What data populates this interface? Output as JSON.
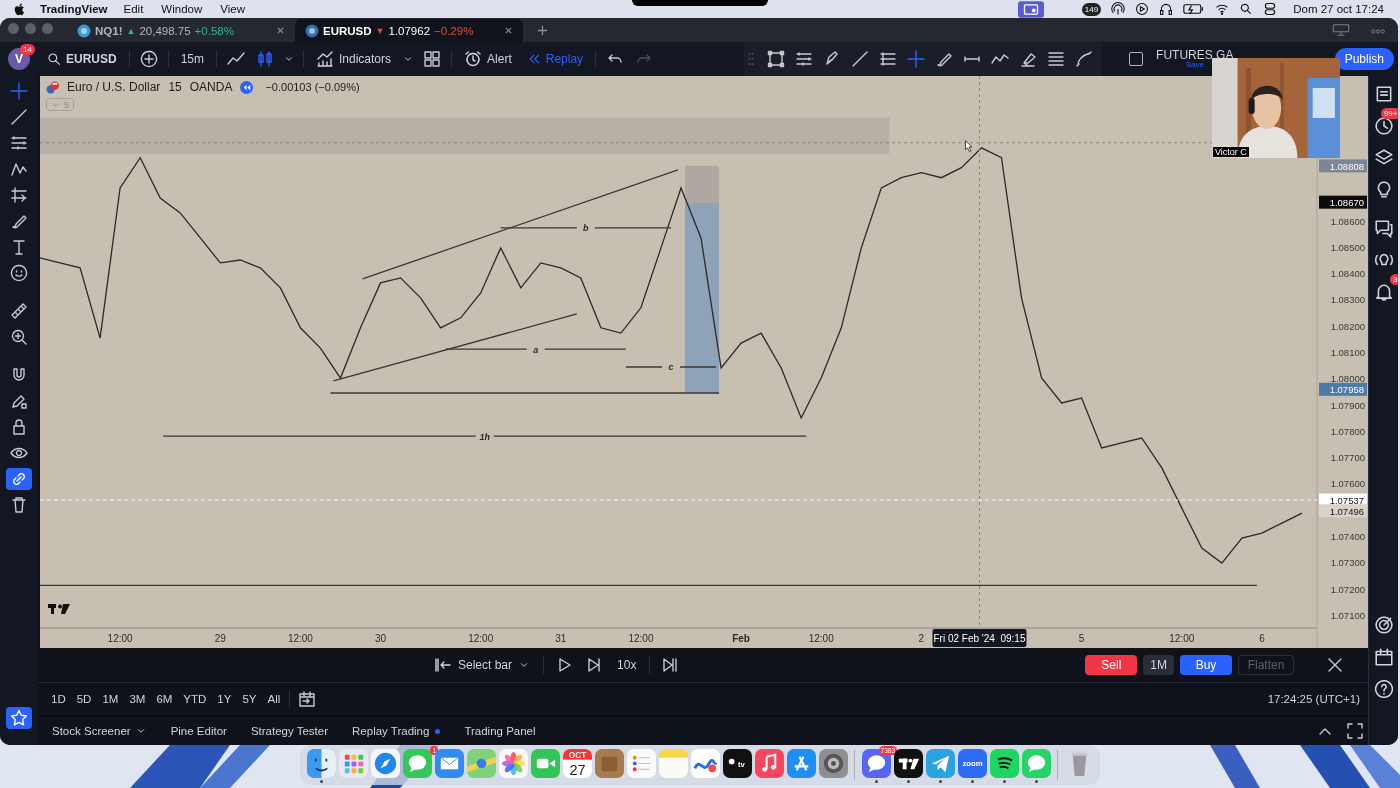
{
  "menubar": {
    "app": "TradingView",
    "menus": [
      "Edit",
      "Window",
      "View"
    ],
    "status_badge": "149",
    "clock": "Dom 27 oct 17:24"
  },
  "tabs": [
    {
      "symbol": "NQ1!",
      "arrow": "▲",
      "rising": true,
      "price": "20,498.75",
      "change": "+0.58%",
      "selected": false
    },
    {
      "symbol": "EURUSD",
      "arrow": "▼",
      "rising": false,
      "price": "1.07962",
      "change": "−0.29%",
      "selected": true
    }
  ],
  "toolbar": {
    "avatar": "V",
    "avatar_badge": "14",
    "symbol": "EURUSD",
    "interval": "15m",
    "indicators": "Indicators",
    "alert": "Alert",
    "replay": "Replay",
    "layout_checked": false,
    "layout_name": "FUTURES GA",
    "save_hint": "Save",
    "publish": "Publish"
  },
  "drawing_tools": [
    {
      "kind": "frame",
      "selected": false
    },
    {
      "kind": "fib",
      "selected": false
    },
    {
      "kind": "pen",
      "selected": false
    },
    {
      "kind": "line",
      "selected": false
    },
    {
      "kind": "levels",
      "selected": false
    },
    {
      "kind": "crosshair",
      "selected": true
    },
    {
      "kind": "brush",
      "selected": false
    },
    {
      "kind": "segment",
      "selected": false
    },
    {
      "kind": "zigzag",
      "selected": false
    },
    {
      "kind": "eraser",
      "selected": false
    },
    {
      "kind": "lines",
      "selected": false
    },
    {
      "kind": "curve",
      "selected": false
    }
  ],
  "left_tools": [
    {
      "kind": "crosshair",
      "selected": true,
      "on": false
    },
    {
      "kind": "line",
      "selected": false,
      "on": false
    },
    {
      "kind": "fib",
      "selected": false,
      "on": false
    },
    {
      "kind": "pattern",
      "selected": false,
      "on": false
    },
    {
      "kind": "forecast",
      "selected": false,
      "on": false
    },
    {
      "kind": "brush",
      "selected": false,
      "on": false
    },
    {
      "kind": "text",
      "selected": false,
      "on": false
    },
    {
      "kind": "emoji",
      "selected": false,
      "on": false
    },
    {
      "kind": "ruler",
      "selected": false,
      "on": false
    },
    {
      "kind": "zoom",
      "selected": false,
      "on": false
    },
    {
      "kind": "magnet",
      "selected": false,
      "on": false
    },
    {
      "kind": "pencil-lock",
      "selected": false,
      "on": false
    },
    {
      "kind": "lock",
      "selected": false,
      "on": false
    },
    {
      "kind": "eye",
      "selected": false,
      "on": false
    },
    {
      "kind": "link",
      "selected": false,
      "on": true
    },
    {
      "kind": "trash",
      "selected": false,
      "on": false
    }
  ],
  "legend": {
    "title": "Euro / U.S. Dollar",
    "interval": "15",
    "source": "OANDA",
    "change": "−0.00103 (−0.09%)",
    "collapsed_count": "5"
  },
  "chart_data": {
    "type": "line",
    "ylim": [
      1.0705,
      1.0915
    ],
    "categories": [
      null,
      null,
      null,
      null,
      "12:00",
      null,
      null,
      null,
      null,
      "29",
      null,
      null,
      null,
      "12:00",
      null,
      null,
      null,
      "30",
      null,
      null,
      null,
      null,
      "12:00",
      null,
      null,
      null,
      "31",
      null,
      null,
      null,
      "12:00",
      null,
      null,
      null,
      null,
      "Feb",
      null,
      null,
      null,
      "12:00",
      null,
      null,
      null,
      null,
      "2",
      null,
      null,
      null,
      null,
      null,
      null,
      null,
      "5",
      null,
      null,
      null,
      null,
      "12:00",
      null,
      null,
      null,
      "6",
      null,
      null
    ],
    "series": [
      {
        "color": "#2a2a2a",
        "values": [
          1.08458,
          1.08439,
          1.0842,
          1.08153,
          1.08724,
          1.08839,
          1.08686,
          1.08629,
          1.08534,
          1.08439,
          1.0845,
          1.0842,
          1.08344,
          1.08192,
          1.08115,
          1.08001,
          1.08192,
          1.08363,
          1.08382,
          1.08306,
          1.08192,
          1.0823,
          1.08325,
          1.08496,
          1.08344,
          1.08439,
          1.0842,
          1.08382,
          1.08192,
          1.08172,
          1.08268,
          1.08496,
          1.08724,
          1.08534,
          1.08039,
          1.08134,
          1.08172,
          1.08039,
          1.07849,
          1.08001,
          1.08192,
          1.08496,
          1.08724,
          1.08763,
          1.08782,
          1.08763,
          1.08801,
          1.08877,
          1.08839,
          1.08306,
          1.08001,
          1.07906,
          1.07925,
          1.07735,
          1.07754,
          1.07773,
          1.07659,
          1.07506,
          1.07354,
          1.07297,
          1.07392,
          1.07411,
          1.07449,
          1.07487
        ]
      }
    ],
    "yticks": [
      {
        "value": 1.071,
        "label": "1.07100"
      },
      {
        "value": 1.072,
        "label": "1.07200"
      },
      {
        "value": 1.073,
        "label": "1.07300"
      },
      {
        "value": 1.074,
        "label": "1.07400"
      },
      {
        "value": 1.076,
        "label": "1.07600"
      },
      {
        "value": 1.077,
        "label": "1.07700"
      },
      {
        "value": 1.078,
        "label": "1.07800"
      },
      {
        "value": 1.079,
        "label": "1.07900"
      },
      {
        "value": 1.08,
        "label": "1.08000"
      },
      {
        "value": 1.081,
        "label": "1.08100"
      },
      {
        "value": 1.082,
        "label": "1.08200"
      },
      {
        "value": 1.083,
        "label": "1.08300"
      },
      {
        "value": 1.084,
        "label": "1.08400"
      },
      {
        "value": 1.085,
        "label": "1.08500"
      },
      {
        "value": 1.086,
        "label": "1.08600"
      }
    ]
  },
  "level_labels": [
    "b",
    "a",
    "c",
    "1h"
  ],
  "crosshair_time": "Fri 02 Feb '24  09:15",
  "price_labels": [
    {
      "value": "1.08808",
      "color": "#7d8694"
    },
    {
      "value": "1.08670",
      "color": "#0b0b0b"
    },
    {
      "value": "1.07958",
      "color": "#4d7aa8"
    },
    {
      "value": "1.07537",
      "color": "#ffffff"
    },
    {
      "value": "1.07496",
      "color": "#d9d3c8"
    }
  ],
  "webcam": {
    "name": "Victor C"
  },
  "replay_bar": {
    "select": "Select bar",
    "speed": "10x",
    "sell": "Sell",
    "quantity": "1M",
    "buy": "Buy",
    "flatten": "Flatten"
  },
  "ranges": [
    "1D",
    "5D",
    "1M",
    "3M",
    "6M",
    "YTD",
    "1Y",
    "5Y",
    "All"
  ],
  "clock": "17:24:25 (UTC+1)",
  "panel_tabs": [
    {
      "label": "Stock Screener",
      "dropdown": true,
      "live": false
    },
    {
      "label": "Pine Editor",
      "dropdown": false,
      "live": false
    },
    {
      "label": "Strategy Tester",
      "dropdown": false,
      "live": false
    },
    {
      "label": "Replay Trading",
      "dropdown": false,
      "live": true
    },
    {
      "label": "Trading Panel",
      "dropdown": false,
      "live": false
    }
  ],
  "right_tools": [
    {
      "kind": "list"
    },
    {
      "kind": "clock",
      "badge": "99+"
    },
    {
      "kind": "layers"
    },
    {
      "kind": "bulb"
    },
    {
      "kind": "chat"
    },
    {
      "kind": "broadcast"
    },
    {
      "kind": "bell",
      "badge": "3"
    }
  ],
  "right_tools_bottom": [
    {
      "kind": "target"
    },
    {
      "kind": "calendar"
    },
    {
      "kind": "help"
    }
  ],
  "dock": [
    {
      "kind": "finder",
      "running": true
    },
    {
      "kind": "launchpad",
      "running": false
    },
    {
      "kind": "safari",
      "running": false
    },
    {
      "kind": "messages",
      "badge": "1",
      "running": false
    },
    {
      "kind": "mail",
      "running": false
    },
    {
      "kind": "maps",
      "running": false
    },
    {
      "kind": "photos",
      "running": false
    },
    {
      "kind": "facetime",
      "running": false
    },
    {
      "kind": "calendar",
      "month": "OCT",
      "day": "27",
      "running": false
    },
    {
      "kind": "box",
      "running": false
    },
    {
      "kind": "reminders",
      "running": false
    },
    {
      "kind": "notes",
      "running": false
    },
    {
      "kind": "freeform",
      "running": false
    },
    {
      "kind": "tv",
      "label": "tv",
      "running": false
    },
    {
      "kind": "music",
      "running": false
    },
    {
      "kind": "appstore",
      "running": false
    },
    {
      "kind": "settings",
      "running": false
    },
    {
      "kind": "separator"
    },
    {
      "kind": "discord",
      "badge": "7383",
      "running": true
    },
    {
      "kind": "tradingview",
      "running": true
    },
    {
      "kind": "telegram",
      "running": true
    },
    {
      "kind": "zoom",
      "label": "zoom",
      "running": true
    },
    {
      "kind": "spotify",
      "running": true
    },
    {
      "kind": "whatsapp",
      "running": true
    },
    {
      "kind": "separator"
    },
    {
      "kind": "trash",
      "running": false
    }
  ]
}
